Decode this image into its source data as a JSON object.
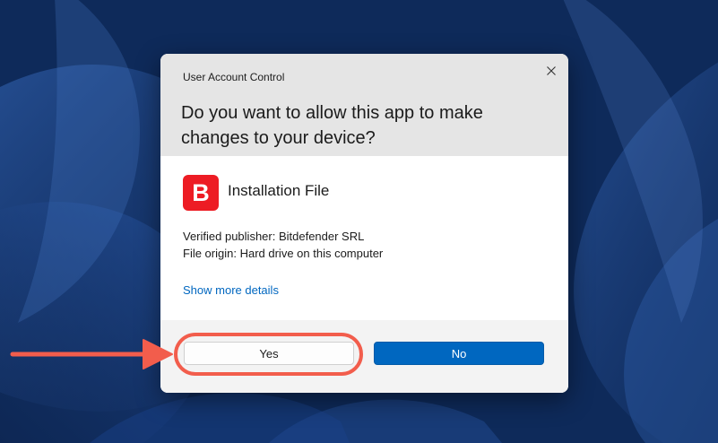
{
  "dialog": {
    "title": "User Account Control",
    "question": "Do you want to allow this app to make changes to your device?",
    "close_icon": "close-icon",
    "app": {
      "name": "Installation File",
      "icon_letter": "B",
      "icon_color": "#ed1c24"
    },
    "details": {
      "publisher": "Verified publisher: Bitdefender SRL",
      "origin": "File origin: Hard drive on this computer"
    },
    "more_details_link": "Show more details",
    "buttons": {
      "yes": "Yes",
      "no": "No"
    }
  },
  "colors": {
    "accent": "#0067c0",
    "annotation": "#f25d4c",
    "header_bg": "#e5e5e5",
    "footer_bg": "#f3f3f3"
  },
  "annotation": {
    "arrow_icon": "right-arrow-icon",
    "highlight": "yes-button-highlight"
  }
}
